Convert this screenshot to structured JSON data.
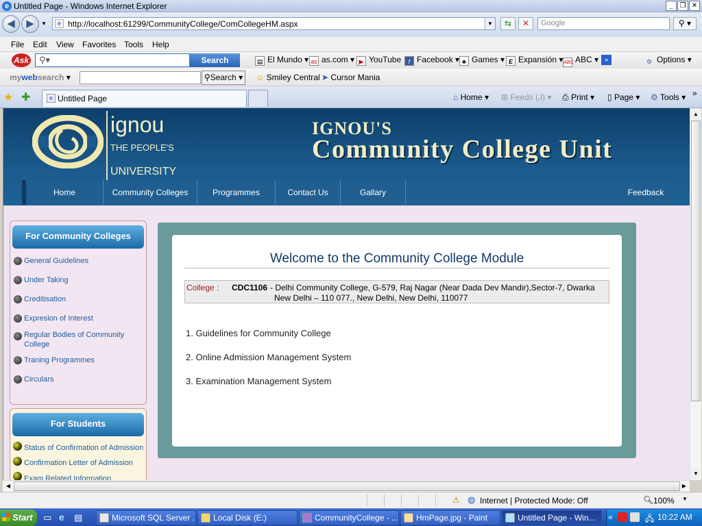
{
  "window": {
    "title": "Untitled Page - Windows Internet Explorer",
    "tab_title": "Untitled Page"
  },
  "address": {
    "url": "http://localhost:61299/CommunityCollege/ComCollegeHM.aspx",
    "search_placeholder": "Google"
  },
  "menu": [
    "File",
    "Edit",
    "View",
    "Favorites",
    "Tools",
    "Help"
  ],
  "ask_toolbar": {
    "logo": "Ask",
    "search_label": "Search",
    "items": [
      "El Mundo",
      "as.com",
      "YouTube",
      "Facebook",
      "Games",
      "Expansión",
      "ABC"
    ],
    "options_label": "Options"
  },
  "mws_toolbar": {
    "logo_my": "my",
    "logo_web": "web",
    "logo_search": "search",
    "search_label": "Search",
    "items": [
      "Smiley Central",
      "Cursor Mania"
    ]
  },
  "command_bar": [
    "Home",
    "Feeds (J)",
    "Print",
    "Page",
    "Tools"
  ],
  "site": {
    "brand_name": "ignou",
    "brand_line1": "THE PEOPLE'S",
    "brand_line2": "UNIVERSITY",
    "unit_line1": "IGNOU'S",
    "unit_line2": "Community College Unit",
    "nav": [
      "Home",
      "Community Colleges",
      "Programmes",
      "Contact Us",
      "Gallary"
    ],
    "feedback": "Feedback"
  },
  "sidebar": {
    "colleges_title": "For Community Colleges",
    "colleges_items": [
      "General Guidelines",
      "Under Taking",
      "Creditisation",
      "Expresion of Interest",
      "Regular Bodies of Community College",
      "Traning Programmes",
      "Circulars"
    ],
    "students_title": "For Students",
    "students_items": [
      "Status of Confirmation of Admission",
      "Confirmation Letter of Admission",
      "Exam Related Information"
    ]
  },
  "main": {
    "welcome": "Welcome to the Community College Module",
    "college_label": "College :",
    "college_code": "CDC1106",
    "college_line1": "- Delhi Community College, G-579, Raj Nagar (Near Dada Dev Mandir),Sector-7, Dwarka",
    "college_line2": "New Delhi – 110 077., New Delhi, New Delhi, 110077",
    "links": [
      "1. Guidelines for Community College",
      "2. Online Admission Management System",
      "3. Examination Management System"
    ]
  },
  "status": {
    "zone": "Internet | Protected Mode: Off",
    "zoom": "100%"
  },
  "taskbar": {
    "start": "Start",
    "tasks": [
      "Microsoft SQL Server ...",
      "Local Disk (E:)",
      "CommunityCollege - ...",
      "HmPage.jpg - Paint",
      "Untitled Page - Win..."
    ],
    "time": "10:22 AM"
  },
  "colors": {
    "banner": "#1b5a8c",
    "main_frame": "#6a9a9a",
    "link": "#1d5c9c",
    "page_bg": "#f0e4f0"
  }
}
